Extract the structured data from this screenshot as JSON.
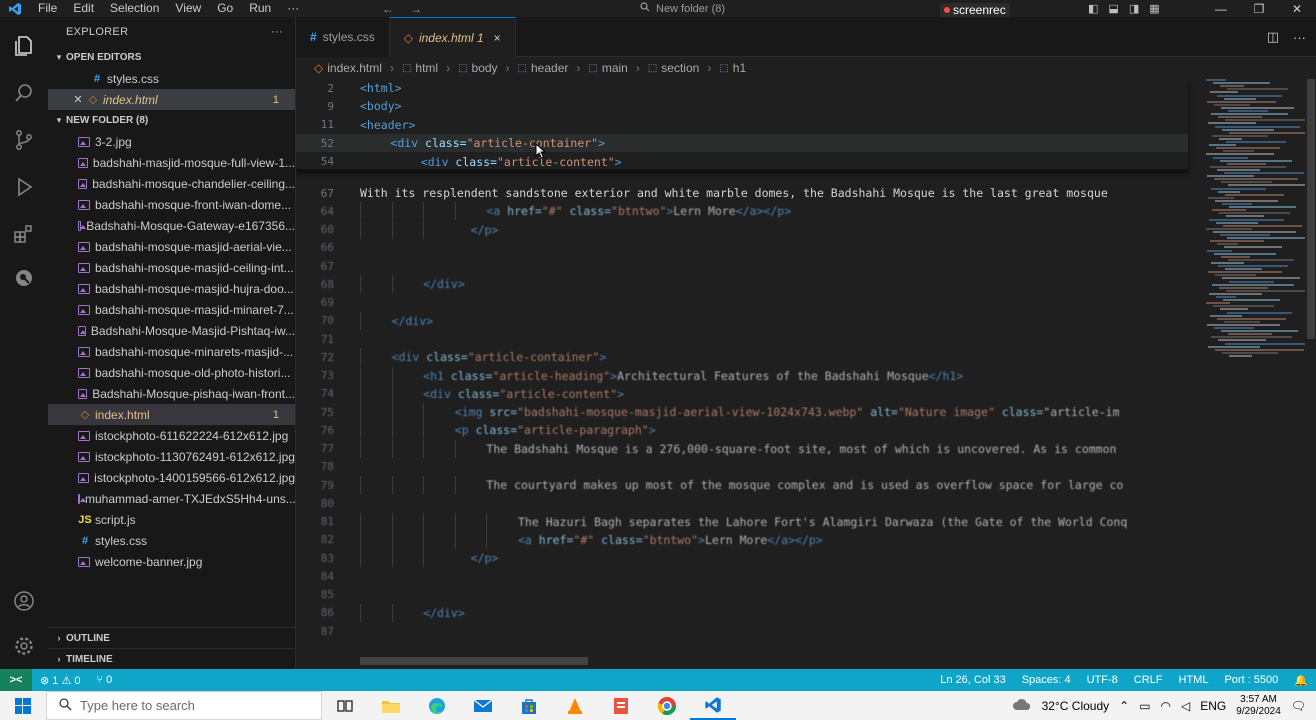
{
  "menu": [
    "File",
    "Edit",
    "Selection",
    "View",
    "Go",
    "Run",
    "···"
  ],
  "window_title": "New folder (8)",
  "screenrec": "screenrec",
  "explorer": {
    "title": "EXPLORER",
    "more": "···",
    "open_editors_label": "OPEN EDITORS",
    "open_editors": [
      {
        "name": "styles.css",
        "type": "css"
      },
      {
        "name": "index.html",
        "type": "html",
        "badge": "1"
      }
    ],
    "folder_label": "NEW FOLDER (8)",
    "files": [
      {
        "name": "3-2.jpg",
        "type": "img"
      },
      {
        "name": "badshahi-masjid-mosque-full-view-1...",
        "type": "img"
      },
      {
        "name": "badshahi-mosque-chandelier-ceiling...",
        "type": "img"
      },
      {
        "name": "badshahi-mosque-front-iwan-dome...",
        "type": "img"
      },
      {
        "name": "Badshahi-Mosque-Gateway-e167356...",
        "type": "img"
      },
      {
        "name": "badshahi-mosque-masjid-aerial-vie...",
        "type": "img"
      },
      {
        "name": "badshahi-mosque-masjid-ceiling-int...",
        "type": "img"
      },
      {
        "name": "badshahi-mosque-masjid-hujra-doo...",
        "type": "img"
      },
      {
        "name": "badshahi-mosque-masjid-minaret-7...",
        "type": "img"
      },
      {
        "name": "Badshahi-Mosque-Masjid-Pishtaq-iw...",
        "type": "img"
      },
      {
        "name": "badshahi-mosque-minarets-masjid-...",
        "type": "img"
      },
      {
        "name": "badshahi-mosque-old-photo-histori...",
        "type": "img"
      },
      {
        "name": "Badshahi-Mosque-pishaq-iwan-front...",
        "type": "img"
      },
      {
        "name": "index.html",
        "type": "html",
        "badge": "1"
      },
      {
        "name": "istockphoto-611622224-612x612.jpg",
        "type": "img"
      },
      {
        "name": "istockphoto-1130762491-612x612.jpg",
        "type": "img"
      },
      {
        "name": "istockphoto-1400159566-612x612.jpg",
        "type": "img"
      },
      {
        "name": "muhammad-amer-TXJEdxS5Hh4-uns...",
        "type": "img"
      },
      {
        "name": "script.js",
        "type": "js"
      },
      {
        "name": "styles.css",
        "type": "css"
      },
      {
        "name": "welcome-banner.jpg",
        "type": "img"
      }
    ],
    "outline_label": "OUTLINE",
    "timeline_label": "TIMELINE"
  },
  "tabs": [
    {
      "label": "styles.css",
      "type": "css"
    },
    {
      "label": "index.html 1",
      "type": "html",
      "close": "×"
    }
  ],
  "breadcrumb": [
    "index.html",
    "html",
    "body",
    "header",
    "main",
    "section",
    "h1"
  ],
  "editor": {
    "sticky": [
      {
        "ln": "2",
        "code": "<html>"
      },
      {
        "ln": "9",
        "code": "<body>"
      },
      {
        "ln": "11",
        "code": "<header>"
      },
      {
        "ln": "52",
        "code": "<div class=\"article-container\">"
      },
      {
        "ln": "54",
        "code": "<div class=\"article-content\">"
      }
    ],
    "lines": [
      {
        "ln": "67",
        "indent": 0,
        "code": "With its resplendent sandstone exterior and white marble domes, the Badshahi Mosque is the last great mosque"
      },
      {
        "ln": "64",
        "indent": 16,
        "code": "<a href=\"#\" class=\"btntwo\">Lern More</a></p>"
      },
      {
        "ln": "60",
        "indent": 14,
        "code": "</p>"
      },
      {
        "ln": "66",
        "indent": 0,
        "code": ""
      },
      {
        "ln": "67",
        "indent": 0,
        "code": ""
      },
      {
        "ln": "68",
        "indent": 8,
        "code": "</div>"
      },
      {
        "ln": "69",
        "indent": 0,
        "code": ""
      },
      {
        "ln": "70",
        "indent": 4,
        "code": "</div>"
      },
      {
        "ln": "71",
        "indent": 0,
        "code": ""
      },
      {
        "ln": "72",
        "indent": 4,
        "code": "<div class=\"article-container\">"
      },
      {
        "ln": "73",
        "indent": 8,
        "code": "<h1 class=\"article-heading\">Architectural Features of the Badshahi Mosque</h1>"
      },
      {
        "ln": "74",
        "indent": 8,
        "code": "<div class=\"article-content\">"
      },
      {
        "ln": "75",
        "indent": 12,
        "code": "<img src=\"badshahi-mosque-masjid-aerial-view-1024x743.webp\" alt=\"Nature image\" class=\"article-im"
      },
      {
        "ln": "76",
        "indent": 12,
        "code": "<p class=\"article-paragraph\">"
      },
      {
        "ln": "77",
        "indent": 16,
        "code": "The Badshahi Mosque is a 276,000-square-foot site, most of which is uncovered. As is common"
      },
      {
        "ln": "78",
        "indent": 0,
        "code": ""
      },
      {
        "ln": "79",
        "indent": 16,
        "code": "The courtyard makes up most of the mosque complex and is used as overflow space for large co"
      },
      {
        "ln": "80",
        "indent": 0,
        "code": ""
      },
      {
        "ln": "81",
        "indent": 20,
        "code": "The Hazuri Bagh separates the Lahore Fort's Alamgiri Darwaza (the Gate of the World Conq"
      },
      {
        "ln": "82",
        "indent": 20,
        "code": "<a href=\"#\" class=\"btntwo\">Lern More</a></p>"
      },
      {
        "ln": "83",
        "indent": 14,
        "code": "</p>"
      },
      {
        "ln": "84",
        "indent": 0,
        "code": ""
      },
      {
        "ln": "85",
        "indent": 0,
        "code": ""
      },
      {
        "ln": "86",
        "indent": 8,
        "code": "</div>"
      },
      {
        "ln": "87",
        "indent": 0,
        "code": ""
      }
    ]
  },
  "status": {
    "remote": "><",
    "errors": "⊗ 1 ⚠ 0",
    "ports": "⑂ 0",
    "position": "Ln 26, Col 33",
    "spaces": "Spaces: 4",
    "encoding": "UTF-8",
    "eol": "CRLF",
    "language": "HTML",
    "port": "Port : 5500"
  },
  "taskbar": {
    "search_placeholder": "Type here to search",
    "weather": "32°C Cloudy",
    "lang": "ENG",
    "time": "3:57 AM",
    "date": "9/29/2024"
  },
  "colors": {
    "statusbar": "#0ea5c8",
    "accent": "#0078d4",
    "modified": "#e2c08d"
  }
}
